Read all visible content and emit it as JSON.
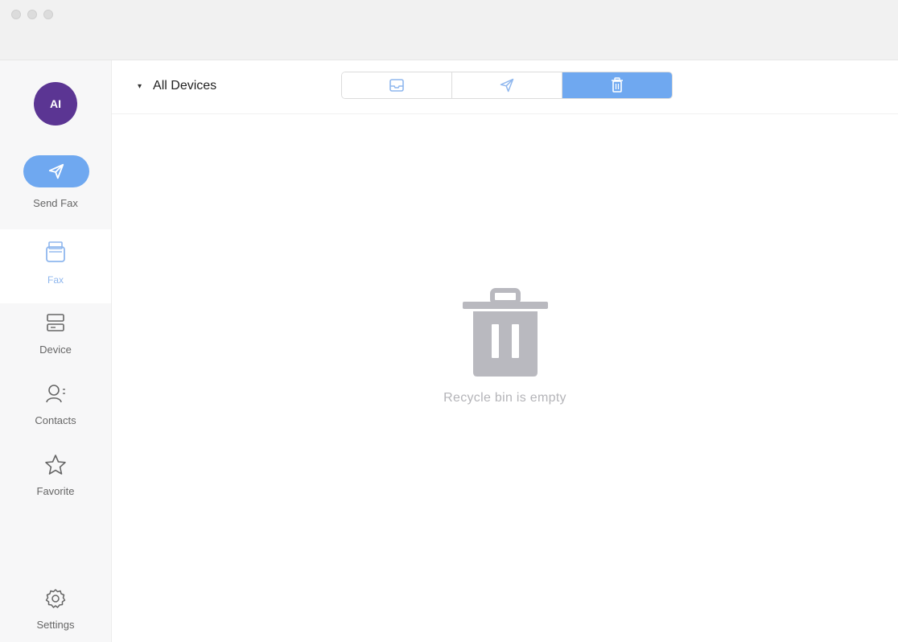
{
  "user": {
    "initials": "AI"
  },
  "sidebar": {
    "send_fax_label": "Send Fax",
    "items": [
      {
        "label": "Fax",
        "icon": "fax-tray-icon",
        "active": true
      },
      {
        "label": "Device",
        "icon": "device-icon",
        "active": false
      },
      {
        "label": "Contacts",
        "icon": "contacts-icon",
        "active": false
      },
      {
        "label": "Favorite",
        "icon": "star-icon",
        "active": false
      }
    ],
    "settings_label": "Settings"
  },
  "toolbar": {
    "device_selector": "All Devices",
    "tabs": [
      {
        "icon": "inbox-icon",
        "active": false
      },
      {
        "icon": "send-icon",
        "active": false
      },
      {
        "icon": "trash-icon",
        "active": true
      }
    ]
  },
  "main": {
    "empty_message": "Recycle bin is empty"
  },
  "colors": {
    "accent": "#6fa8f0",
    "avatar_bg": "#5b3593",
    "empty_icon": "#b9b9bf"
  }
}
